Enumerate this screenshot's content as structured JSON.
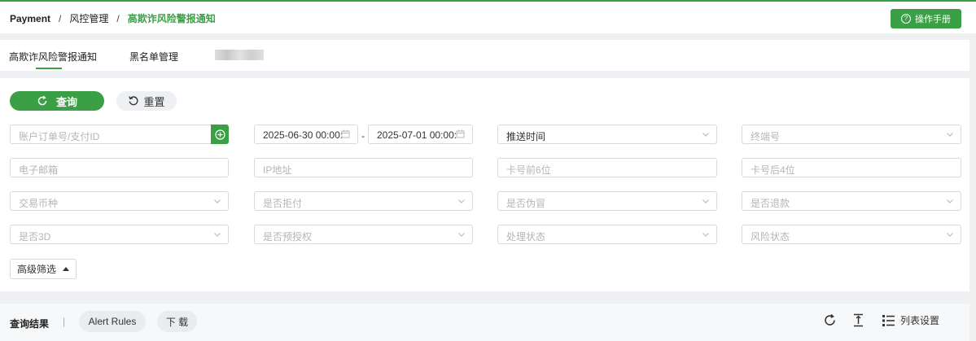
{
  "breadcrumb": {
    "items": [
      "Payment",
      "风控管理",
      "高欺诈风险警报通知"
    ],
    "separator": "/"
  },
  "header": {
    "manual_button": "操作手册",
    "manual_icon": "help-circle-icon"
  },
  "tabs": [
    {
      "label": "高欺诈风险警报通知",
      "active": true
    },
    {
      "label": "黑名单管理",
      "active": false
    }
  ],
  "actions": {
    "query": "查询",
    "reset": "重置"
  },
  "filters": {
    "order_id": "账户订单号/支付ID",
    "start_date": "2025-06-30 00:00:",
    "date_dash": "-",
    "end_date": "2025-07-01 00:00:",
    "push_time": "推送时间",
    "terminal_no": "终端号",
    "email": "电子邮箱",
    "ip": "IP地址",
    "card_first6": "卡号前6位",
    "card_last4": "卡号后4位",
    "currency": "交易币种",
    "is_declined": "是否拒付",
    "is_fake": "是否伪冒",
    "is_refund": "是否退款",
    "is_3d": "是否3D",
    "is_preauth": "是否预授权",
    "process_status": "处理状态",
    "risk_status": "风险状态"
  },
  "advanced_filter": "高级筛选",
  "results": {
    "label": "查询结果",
    "separator": "|",
    "alert_rules": "Alert Rules",
    "download": "下 载",
    "column_settings": "列表设置"
  },
  "colors": {
    "accent": "#3a9f45",
    "background": "#eef0f3"
  }
}
